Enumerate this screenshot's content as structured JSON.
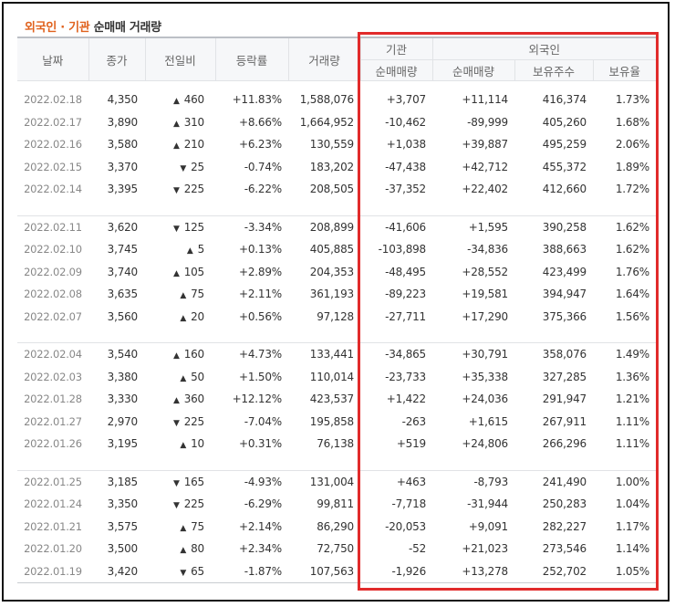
{
  "title": {
    "part1": "외국인 · 기관",
    "part2": "순매매 거래량"
  },
  "headers": {
    "date": "날짜",
    "close": "종가",
    "change": "전일비",
    "rate": "등락률",
    "volume": "거래량",
    "inst": "기관",
    "foreign": "외국인",
    "inst_net": "순매매량",
    "foreign_net": "순매매량",
    "foreign_holdings": "보유주수",
    "foreign_ratio": "보유율"
  },
  "colors": {
    "up": "#d51b1b",
    "down": "#1b59b5",
    "highlight_box": "#e12b2b",
    "title_accent": "#e0621e"
  },
  "groups": [
    [
      {
        "date": "2022.02.18",
        "close": "4,350",
        "dir": "up",
        "change": "460",
        "rate": "+11.83%",
        "volume": "1,588,076",
        "inst": "+3,707",
        "foreign": "+11,114",
        "holdings": "416,374",
        "ratio": "1.73%"
      },
      {
        "date": "2022.02.17",
        "close": "3,890",
        "dir": "up",
        "change": "310",
        "rate": "+8.66%",
        "volume": "1,664,952",
        "inst": "-10,462",
        "foreign": "-89,999",
        "holdings": "405,260",
        "ratio": "1.68%"
      },
      {
        "date": "2022.02.16",
        "close": "3,580",
        "dir": "up",
        "change": "210",
        "rate": "+6.23%",
        "volume": "130,559",
        "inst": "+1,038",
        "foreign": "+39,887",
        "holdings": "495,259",
        "ratio": "2.06%"
      },
      {
        "date": "2022.02.15",
        "close": "3,370",
        "dir": "down",
        "change": "25",
        "rate": "-0.74%",
        "volume": "183,202",
        "inst": "-47,438",
        "foreign": "+42,712",
        "holdings": "455,372",
        "ratio": "1.89%"
      },
      {
        "date": "2022.02.14",
        "close": "3,395",
        "dir": "down",
        "change": "225",
        "rate": "-6.22%",
        "volume": "208,505",
        "inst": "-37,352",
        "foreign": "+22,402",
        "holdings": "412,660",
        "ratio": "1.72%"
      }
    ],
    [
      {
        "date": "2022.02.11",
        "close": "3,620",
        "dir": "down",
        "change": "125",
        "rate": "-3.34%",
        "volume": "208,899",
        "inst": "-41,606",
        "foreign": "+1,595",
        "holdings": "390,258",
        "ratio": "1.62%"
      },
      {
        "date": "2022.02.10",
        "close": "3,745",
        "dir": "up",
        "change": "5",
        "rate": "+0.13%",
        "volume": "405,885",
        "inst": "-103,898",
        "foreign": "-34,836",
        "holdings": "388,663",
        "ratio": "1.62%"
      },
      {
        "date": "2022.02.09",
        "close": "3,740",
        "dir": "up",
        "change": "105",
        "rate": "+2.89%",
        "volume": "204,353",
        "inst": "-48,495",
        "foreign": "+28,552",
        "holdings": "423,499",
        "ratio": "1.76%"
      },
      {
        "date": "2022.02.08",
        "close": "3,635",
        "dir": "up",
        "change": "75",
        "rate": "+2.11%",
        "volume": "361,193",
        "inst": "-89,223",
        "foreign": "+19,581",
        "holdings": "394,947",
        "ratio": "1.64%"
      },
      {
        "date": "2022.02.07",
        "close": "3,560",
        "dir": "up",
        "change": "20",
        "rate": "+0.56%",
        "volume": "97,128",
        "inst": "-27,711",
        "foreign": "+17,290",
        "holdings": "375,366",
        "ratio": "1.56%"
      }
    ],
    [
      {
        "date": "2022.02.04",
        "close": "3,540",
        "dir": "up",
        "change": "160",
        "rate": "+4.73%",
        "volume": "133,441",
        "inst": "-34,865",
        "foreign": "+30,791",
        "holdings": "358,076",
        "ratio": "1.49%"
      },
      {
        "date": "2022.02.03",
        "close": "3,380",
        "dir": "up",
        "change": "50",
        "rate": "+1.50%",
        "volume": "110,014",
        "inst": "-23,733",
        "foreign": "+35,338",
        "holdings": "327,285",
        "ratio": "1.36%"
      },
      {
        "date": "2022.01.28",
        "close": "3,330",
        "dir": "up",
        "change": "360",
        "rate": "+12.12%",
        "volume": "423,537",
        "inst": "+1,422",
        "foreign": "+24,036",
        "holdings": "291,947",
        "ratio": "1.21%"
      },
      {
        "date": "2022.01.27",
        "close": "2,970",
        "dir": "down",
        "change": "225",
        "rate": "-7.04%",
        "volume": "195,858",
        "inst": "-263",
        "foreign": "+1,615",
        "holdings": "267,911",
        "ratio": "1.11%"
      },
      {
        "date": "2022.01.26",
        "close": "3,195",
        "dir": "up",
        "change": "10",
        "rate": "+0.31%",
        "volume": "76,138",
        "inst": "+519",
        "foreign": "+24,806",
        "holdings": "266,296",
        "ratio": "1.11%"
      }
    ],
    [
      {
        "date": "2022.01.25",
        "close": "3,185",
        "dir": "down",
        "change": "165",
        "rate": "-4.93%",
        "volume": "131,004",
        "inst": "+463",
        "foreign": "-8,793",
        "holdings": "241,490",
        "ratio": "1.00%"
      },
      {
        "date": "2022.01.24",
        "close": "3,350",
        "dir": "down",
        "change": "225",
        "rate": "-6.29%",
        "volume": "99,811",
        "inst": "-7,718",
        "foreign": "-31,944",
        "holdings": "250,283",
        "ratio": "1.04%"
      },
      {
        "date": "2022.01.21",
        "close": "3,575",
        "dir": "up",
        "change": "75",
        "rate": "+2.14%",
        "volume": "86,290",
        "inst": "-20,053",
        "foreign": "+9,091",
        "holdings": "282,227",
        "ratio": "1.17%"
      },
      {
        "date": "2022.01.20",
        "close": "3,500",
        "dir": "up",
        "change": "80",
        "rate": "+2.34%",
        "volume": "72,750",
        "inst": "-52",
        "foreign": "+21,023",
        "holdings": "273,546",
        "ratio": "1.14%"
      },
      {
        "date": "2022.01.19",
        "close": "3,420",
        "dir": "down",
        "change": "65",
        "rate": "-1.87%",
        "volume": "107,563",
        "inst": "-1,926",
        "foreign": "+13,278",
        "holdings": "252,702",
        "ratio": "1.05%"
      }
    ]
  ]
}
